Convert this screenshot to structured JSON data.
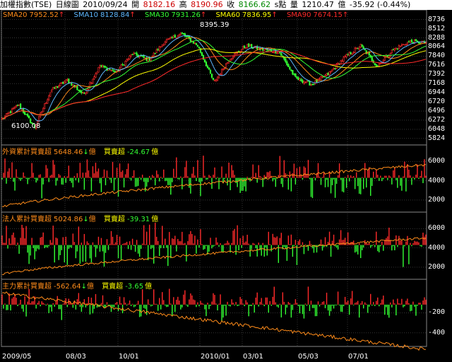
{
  "header": {
    "title": "加權指數(TSE)",
    "period": "日線圖",
    "date": "2010/09/24",
    "open_label": "開",
    "open": "8182.16",
    "high_label": "高",
    "high": "8190.96",
    "close_label": "收",
    "close": "8166.62",
    "close_suffix": "s點",
    "volume_label": "量",
    "volume": "1210.47",
    "volume_unit": "億",
    "change": "-35.92 (-0.44%)"
  },
  "sma": [
    {
      "label": "SMA20",
      "value": "7952.52",
      "arrow": "↑",
      "color": "#ff8c1a"
    },
    {
      "label": "SMA10",
      "value": "8128.84",
      "arrow": "↑",
      "color": "#5fb8ff"
    },
    {
      "label": "SMA30",
      "value": "7931.26",
      "arrow": "↑",
      "color": "#33ff33"
    },
    {
      "label": "SMA60",
      "value": "7836.95",
      "arrow": "↑",
      "color": "#ffff00"
    },
    {
      "label": "SMA90",
      "value": "7674.15",
      "arrow": "↑",
      "color": "#ff2a2a"
    }
  ],
  "panels": [
    {
      "label": "外資累計買賣超",
      "value": "5648.46",
      "arrow": "↓",
      "unit": "億",
      "net_label": "買賣超",
      "net_value": "-24.67",
      "net_unit": "億"
    },
    {
      "label": "法人累計買賣超",
      "value": "5024.86",
      "arrow": "↓",
      "unit": "億",
      "net_label": "買賣超",
      "net_value": "-39.31",
      "net_unit": "億"
    },
    {
      "label": "主力累計買賣超",
      "value": "-562.64",
      "arrow": "↓",
      "unit": "億",
      "net_label": "買賣超",
      "net_value": "-3.65",
      "net_unit": "億"
    }
  ],
  "annotations": {
    "high": "8395.39",
    "low": "6100.08"
  },
  "colors": {
    "up": "#ff2a2a",
    "down": "#33ff33",
    "cum": "#ff8c1a",
    "grid": "#555555"
  },
  "chart_data": [
    {
      "type": "candlestick",
      "ylim": [
        5700,
        8800
      ],
      "y_ticks": [
        "8736",
        "8512",
        "8288",
        "8064",
        "7840",
        "7616",
        "7392",
        "7168",
        "6944",
        "6720",
        "6496",
        "6272",
        "6048",
        "5824"
      ],
      "x_ticks": [
        "2009/05",
        "08/03",
        "10/01",
        "2010/01",
        "03/01",
        "05/03",
        "07/01"
      ],
      "anchor_closes": [
        6300,
        6650,
        6100,
        7000,
        7250,
        6900,
        7600,
        7450,
        7900,
        7750,
        8200,
        8395,
        8100,
        7200,
        7800,
        8100,
        8000,
        7950,
        7300,
        7150,
        7400,
        7800,
        8100,
        7600,
        8000,
        8200,
        8166
      ]
    },
    {
      "type": "bar",
      "title": "外資累計買賣超",
      "y_ticks": [
        "6000",
        "4000",
        "2000"
      ],
      "ylim": [
        900,
        6900
      ],
      "cum_range": [
        1300,
        5650
      ]
    },
    {
      "type": "bar",
      "title": "法人累計買賣超",
      "y_ticks": [
        "6000",
        "4000",
        "2000"
      ],
      "ylim": [
        900,
        6900
      ],
      "cum_range": [
        1300,
        5025
      ]
    },
    {
      "type": "bar",
      "title": "主力累計買賣超",
      "y_ticks": [
        "-200",
        "-400"
      ],
      "ylim": [
        -520,
        40
      ],
      "cum_range": [
        -5,
        -563
      ]
    }
  ]
}
